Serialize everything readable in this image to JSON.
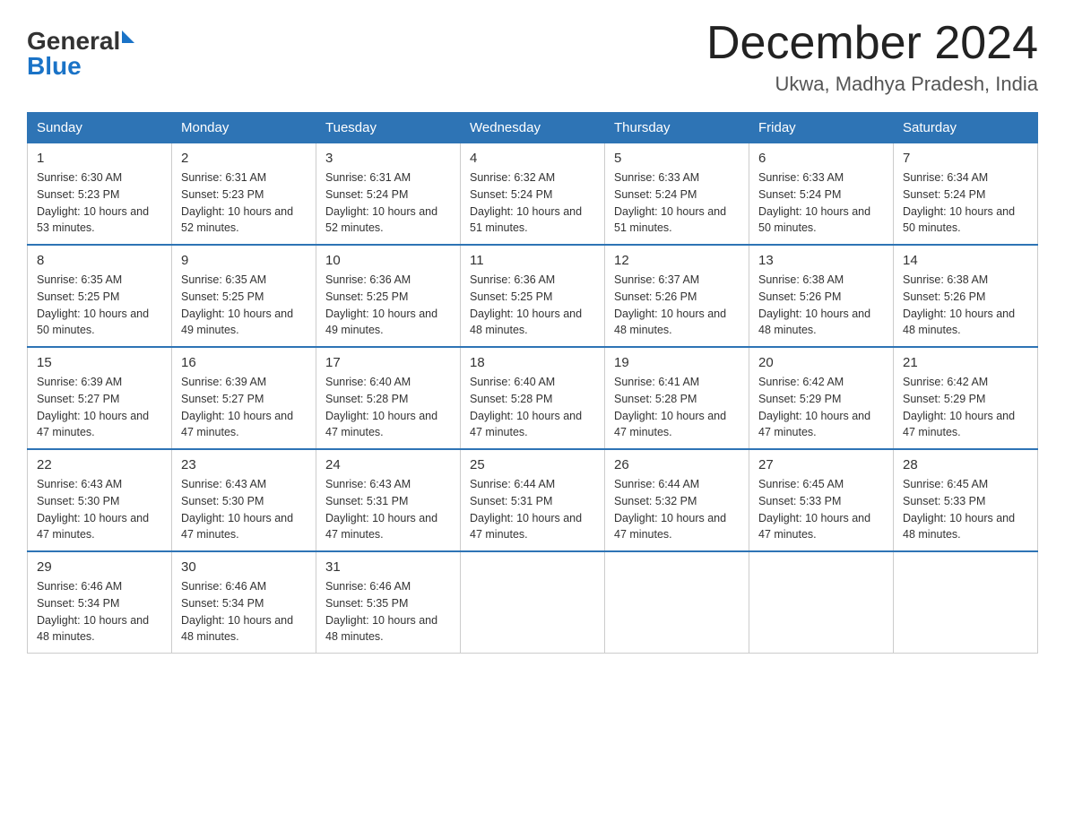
{
  "header": {
    "logo_general": "General",
    "logo_blue": "Blue",
    "month_title": "December 2024",
    "location": "Ukwa, Madhya Pradesh, India"
  },
  "days_of_week": [
    "Sunday",
    "Monday",
    "Tuesday",
    "Wednesday",
    "Thursday",
    "Friday",
    "Saturday"
  ],
  "weeks": [
    [
      {
        "day": "1",
        "sunrise": "6:30 AM",
        "sunset": "5:23 PM",
        "daylight": "10 hours and 53 minutes."
      },
      {
        "day": "2",
        "sunrise": "6:31 AM",
        "sunset": "5:23 PM",
        "daylight": "10 hours and 52 minutes."
      },
      {
        "day": "3",
        "sunrise": "6:31 AM",
        "sunset": "5:24 PM",
        "daylight": "10 hours and 52 minutes."
      },
      {
        "day": "4",
        "sunrise": "6:32 AM",
        "sunset": "5:24 PM",
        "daylight": "10 hours and 51 minutes."
      },
      {
        "day": "5",
        "sunrise": "6:33 AM",
        "sunset": "5:24 PM",
        "daylight": "10 hours and 51 minutes."
      },
      {
        "day": "6",
        "sunrise": "6:33 AM",
        "sunset": "5:24 PM",
        "daylight": "10 hours and 50 minutes."
      },
      {
        "day": "7",
        "sunrise": "6:34 AM",
        "sunset": "5:24 PM",
        "daylight": "10 hours and 50 minutes."
      }
    ],
    [
      {
        "day": "8",
        "sunrise": "6:35 AM",
        "sunset": "5:25 PM",
        "daylight": "10 hours and 50 minutes."
      },
      {
        "day": "9",
        "sunrise": "6:35 AM",
        "sunset": "5:25 PM",
        "daylight": "10 hours and 49 minutes."
      },
      {
        "day": "10",
        "sunrise": "6:36 AM",
        "sunset": "5:25 PM",
        "daylight": "10 hours and 49 minutes."
      },
      {
        "day": "11",
        "sunrise": "6:36 AM",
        "sunset": "5:25 PM",
        "daylight": "10 hours and 48 minutes."
      },
      {
        "day": "12",
        "sunrise": "6:37 AM",
        "sunset": "5:26 PM",
        "daylight": "10 hours and 48 minutes."
      },
      {
        "day": "13",
        "sunrise": "6:38 AM",
        "sunset": "5:26 PM",
        "daylight": "10 hours and 48 minutes."
      },
      {
        "day": "14",
        "sunrise": "6:38 AM",
        "sunset": "5:26 PM",
        "daylight": "10 hours and 48 minutes."
      }
    ],
    [
      {
        "day": "15",
        "sunrise": "6:39 AM",
        "sunset": "5:27 PM",
        "daylight": "10 hours and 47 minutes."
      },
      {
        "day": "16",
        "sunrise": "6:39 AM",
        "sunset": "5:27 PM",
        "daylight": "10 hours and 47 minutes."
      },
      {
        "day": "17",
        "sunrise": "6:40 AM",
        "sunset": "5:28 PM",
        "daylight": "10 hours and 47 minutes."
      },
      {
        "day": "18",
        "sunrise": "6:40 AM",
        "sunset": "5:28 PM",
        "daylight": "10 hours and 47 minutes."
      },
      {
        "day": "19",
        "sunrise": "6:41 AM",
        "sunset": "5:28 PM",
        "daylight": "10 hours and 47 minutes."
      },
      {
        "day": "20",
        "sunrise": "6:42 AM",
        "sunset": "5:29 PM",
        "daylight": "10 hours and 47 minutes."
      },
      {
        "day": "21",
        "sunrise": "6:42 AM",
        "sunset": "5:29 PM",
        "daylight": "10 hours and 47 minutes."
      }
    ],
    [
      {
        "day": "22",
        "sunrise": "6:43 AM",
        "sunset": "5:30 PM",
        "daylight": "10 hours and 47 minutes."
      },
      {
        "day": "23",
        "sunrise": "6:43 AM",
        "sunset": "5:30 PM",
        "daylight": "10 hours and 47 minutes."
      },
      {
        "day": "24",
        "sunrise": "6:43 AM",
        "sunset": "5:31 PM",
        "daylight": "10 hours and 47 minutes."
      },
      {
        "day": "25",
        "sunrise": "6:44 AM",
        "sunset": "5:31 PM",
        "daylight": "10 hours and 47 minutes."
      },
      {
        "day": "26",
        "sunrise": "6:44 AM",
        "sunset": "5:32 PM",
        "daylight": "10 hours and 47 minutes."
      },
      {
        "day": "27",
        "sunrise": "6:45 AM",
        "sunset": "5:33 PM",
        "daylight": "10 hours and 47 minutes."
      },
      {
        "day": "28",
        "sunrise": "6:45 AM",
        "sunset": "5:33 PM",
        "daylight": "10 hours and 48 minutes."
      }
    ],
    [
      {
        "day": "29",
        "sunrise": "6:46 AM",
        "sunset": "5:34 PM",
        "daylight": "10 hours and 48 minutes."
      },
      {
        "day": "30",
        "sunrise": "6:46 AM",
        "sunset": "5:34 PM",
        "daylight": "10 hours and 48 minutes."
      },
      {
        "day": "31",
        "sunrise": "6:46 AM",
        "sunset": "5:35 PM",
        "daylight": "10 hours and 48 minutes."
      },
      null,
      null,
      null,
      null
    ]
  ]
}
